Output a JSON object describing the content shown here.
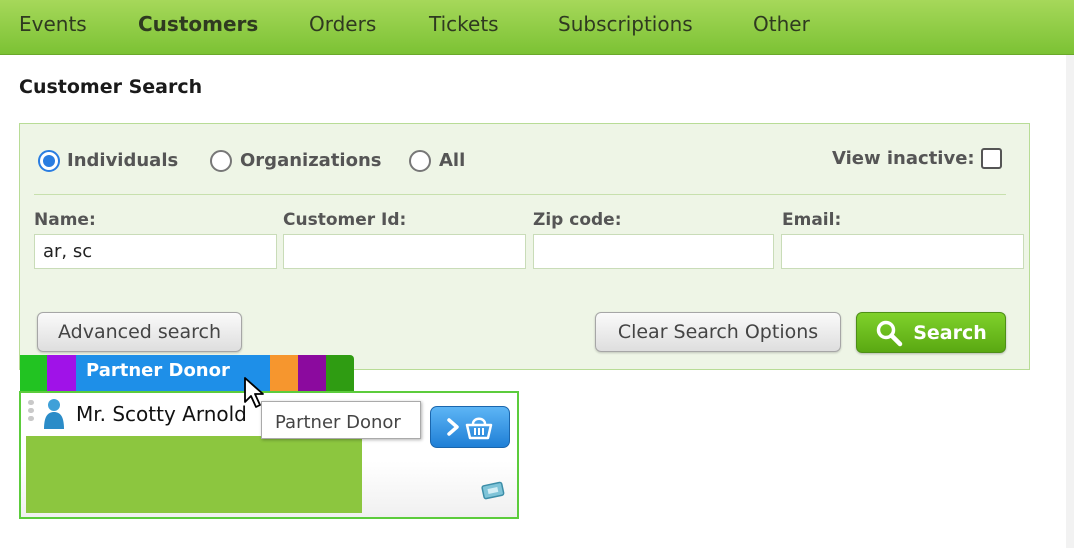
{
  "nav": {
    "tabs": [
      {
        "label": "Events"
      },
      {
        "label": "Customers"
      },
      {
        "label": "Orders"
      },
      {
        "label": "Tickets"
      },
      {
        "label": "Subscriptions"
      },
      {
        "label": "Other"
      }
    ],
    "active": "Customers"
  },
  "page": {
    "title": "Customer Search"
  },
  "search": {
    "types": [
      {
        "label": "Individuals",
        "checked": true
      },
      {
        "label": "Organizations",
        "checked": false
      },
      {
        "label": "All",
        "checked": false
      }
    ],
    "view_inactive_label": "View inactive:",
    "view_inactive_checked": false,
    "fields": {
      "name": {
        "label": "Name:",
        "value": "ar, sc"
      },
      "customer_id": {
        "label": "Customer Id:",
        "value": ""
      },
      "zip": {
        "label": "Zip code:",
        "value": ""
      },
      "email": {
        "label": "Email:",
        "value": ""
      }
    },
    "advanced_label": "Advanced search",
    "clear_label": "Clear Search Options",
    "search_label": "Search"
  },
  "result": {
    "tag_label": "Partner Donor",
    "customer_name": "Mr. Scotty Arnold",
    "tooltip": "Partner Donor"
  },
  "colors": {
    "nav_bg": "#8ccd44",
    "accent_green": "#6ec01f",
    "tag_blue": "#1e8fe8",
    "tag_segments": [
      "#22c322",
      "#a012e8",
      "#1e8fe8",
      "#f6962e",
      "#8b0a9e",
      "#2f9c12"
    ]
  },
  "icons": {
    "search": "magnifier-icon",
    "person": "person-icon",
    "basket": "basket-icon",
    "ticket": "ticket-icon"
  }
}
